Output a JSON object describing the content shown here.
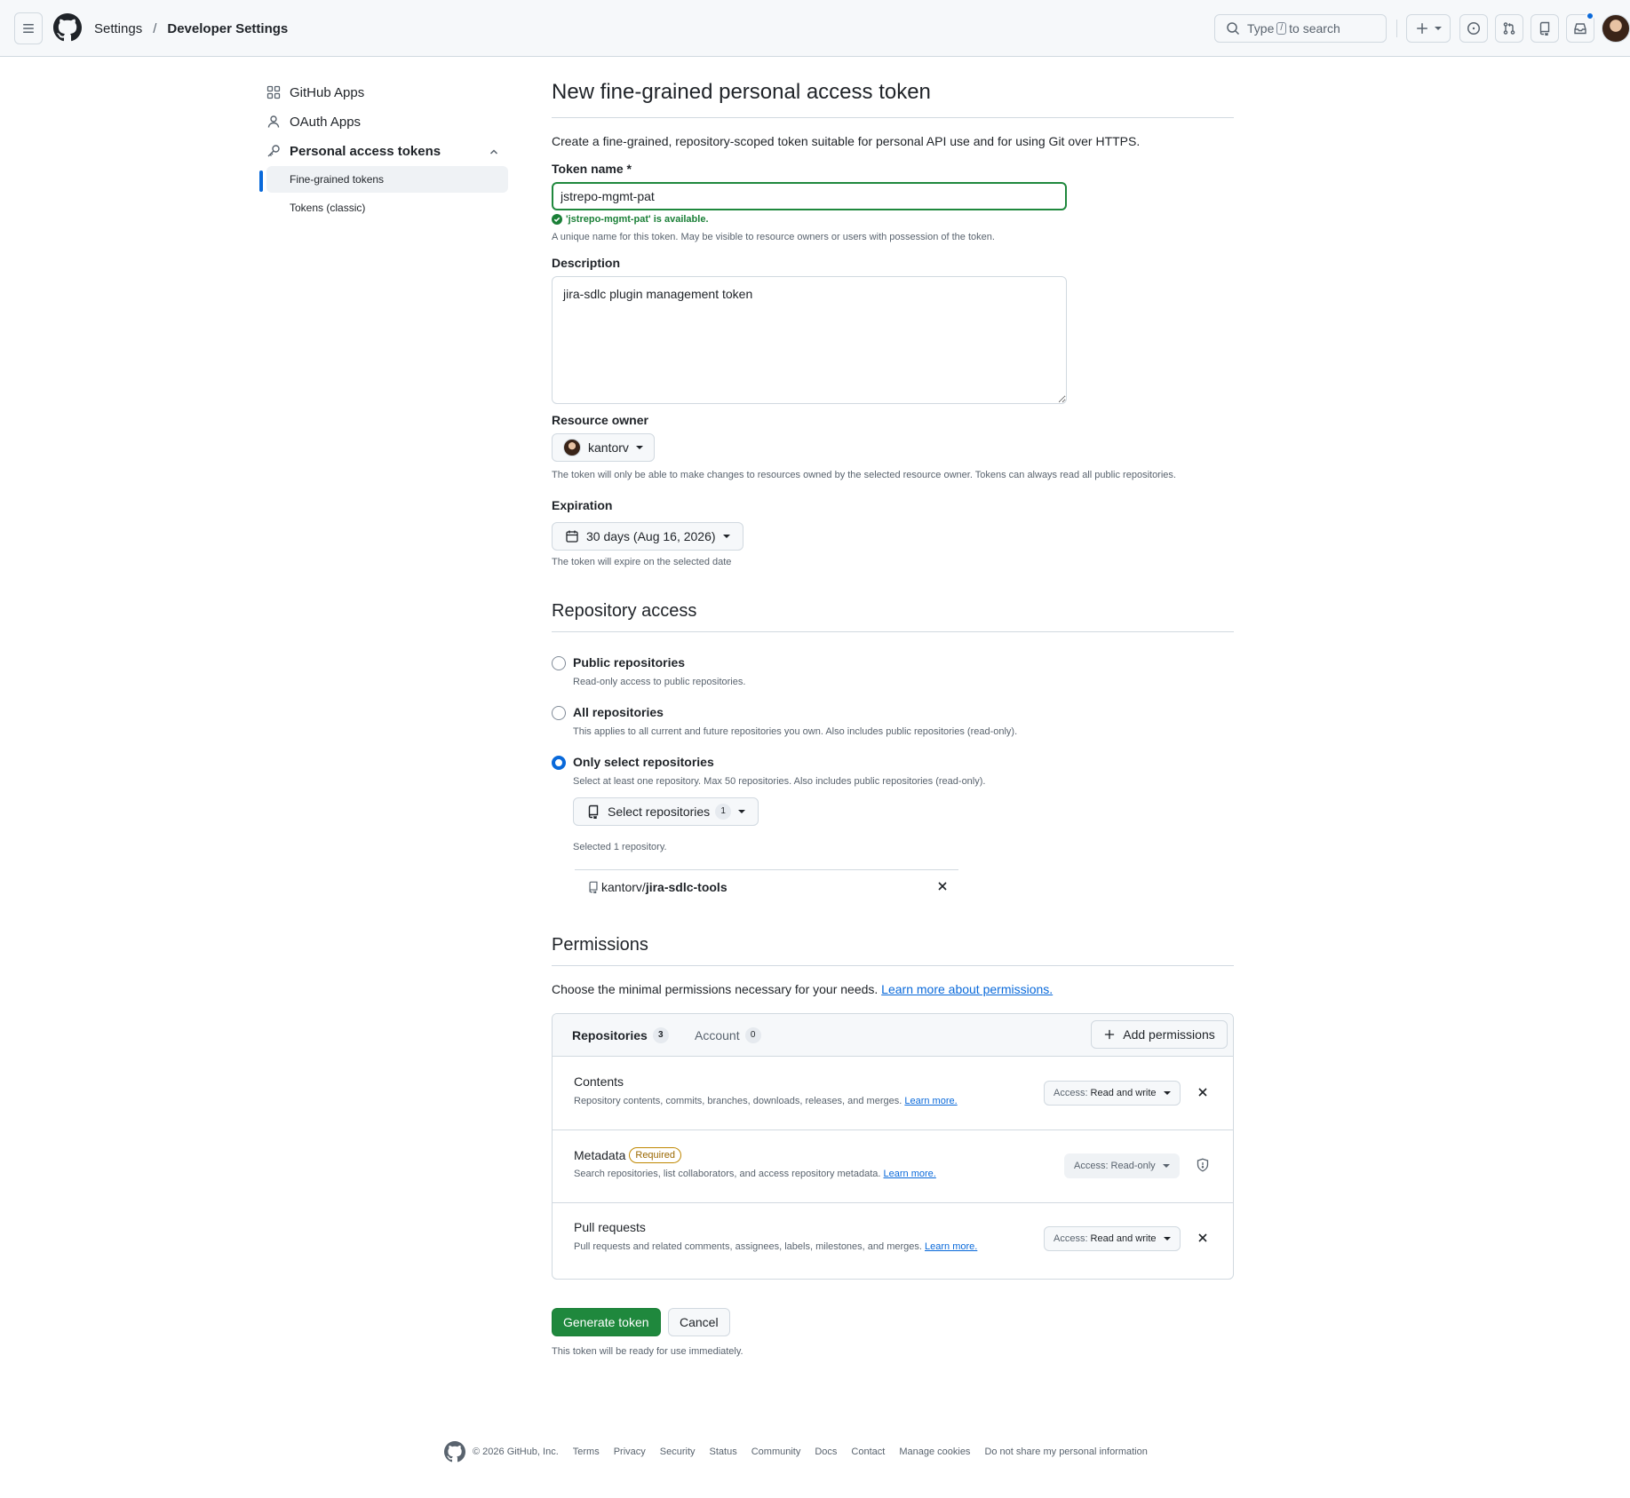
{
  "header": {
    "breadcrumb": [
      "Settings",
      "Developer Settings"
    ],
    "breadcrumb_separator": "/",
    "search": {
      "prefix": "Type",
      "key": "/",
      "suffix": "to search"
    }
  },
  "sidebar": {
    "items": [
      {
        "label": "GitHub Apps",
        "icon": "apps-icon"
      },
      {
        "label": "OAuth Apps",
        "icon": "person-icon"
      },
      {
        "label": "Personal access tokens",
        "icon": "key-icon",
        "expanded": true
      }
    ],
    "subitems": [
      {
        "label": "Fine-grained tokens",
        "active": true
      },
      {
        "label": "Tokens (classic)",
        "active": false
      }
    ]
  },
  "page": {
    "title": "New fine-grained personal access token",
    "intro": "Create a fine-grained, repository-scoped token suitable for personal API use and for using Git over HTTPS."
  },
  "token_name": {
    "label": "Token name *",
    "value": "jstrepo-mgmt-pat",
    "available": "'jstrepo-mgmt-pat' is available.",
    "note": "A unique name for this token. May be visible to resource owners or users with possession of the token."
  },
  "description": {
    "label": "Description",
    "value": "jira-sdlc plugin management token"
  },
  "resource_owner": {
    "label": "Resource owner",
    "value": "kantorv",
    "note": "The token will only be able to make changes to resources owned by the selected resource owner. Tokens can always read all public repositories."
  },
  "expiration": {
    "label": "Expiration",
    "value": "30 days (Aug 16, 2026)",
    "note": "The token will expire on the selected date"
  },
  "repository_access": {
    "heading": "Repository access",
    "options": [
      {
        "label": "Public repositories",
        "note": "Read-only access to public repositories.",
        "checked": false
      },
      {
        "label": "All repositories",
        "note": "This applies to all current and future repositories you own. Also includes public repositories (read-only).",
        "checked": false
      },
      {
        "label": "Only select repositories",
        "note": "Select at least one repository. Max 50 repositories. Also includes public repositories (read-only).",
        "checked": true
      }
    ],
    "select_button": "Select repositories",
    "select_count": "1",
    "selected_summary": "Selected 1 repository.",
    "selected_repo": {
      "owner": "kantorv/",
      "name": "jira-sdlc-tools"
    }
  },
  "permissions": {
    "heading": "Permissions",
    "intro": "Choose the minimal permissions necessary for your needs.",
    "intro_link": "Learn more about permissions.",
    "tabs": [
      {
        "label": "Repositories",
        "count": "3",
        "active": true
      },
      {
        "label": "Account",
        "count": "0",
        "active": false
      }
    ],
    "add_button": "Add permissions",
    "rows": [
      {
        "title": "Contents",
        "badge": "",
        "desc": "Repository contents, commits, branches, downloads, releases, and merges.",
        "link": "Learn more.",
        "access_key": "Access:",
        "access_value": "Read and write",
        "action_icon": "close-icon"
      },
      {
        "title": "Metadata",
        "badge": "Required",
        "desc": "Search repositories, list collaborators, and access repository metadata.",
        "link": "Learn more.",
        "access_key": "Access:",
        "access_value": "Read-only",
        "action_icon": "shield-icon"
      },
      {
        "title": "Pull requests",
        "badge": "",
        "desc": "Pull requests and related comments, assignees, labels, milestones, and merges.",
        "link": "Learn more.",
        "access_key": "Access:",
        "access_value": "Read and write",
        "action_icon": "close-icon"
      }
    ]
  },
  "actions": {
    "generate": "Generate token",
    "cancel": "Cancel",
    "note": "This token will be ready for use immediately."
  },
  "footer": {
    "copyright": "© 2026 GitHub, Inc.",
    "links": [
      "Terms",
      "Privacy",
      "Security",
      "Status",
      "Community",
      "Docs",
      "Contact",
      "Manage cookies",
      "Do not share my personal information"
    ]
  },
  "colors": {
    "accent": "#0969da",
    "success": "#1f883d",
    "success_text": "#1a7f37",
    "border": "#d1d9e0",
    "muted": "#59636e",
    "badge_attention": "#9a6700"
  }
}
